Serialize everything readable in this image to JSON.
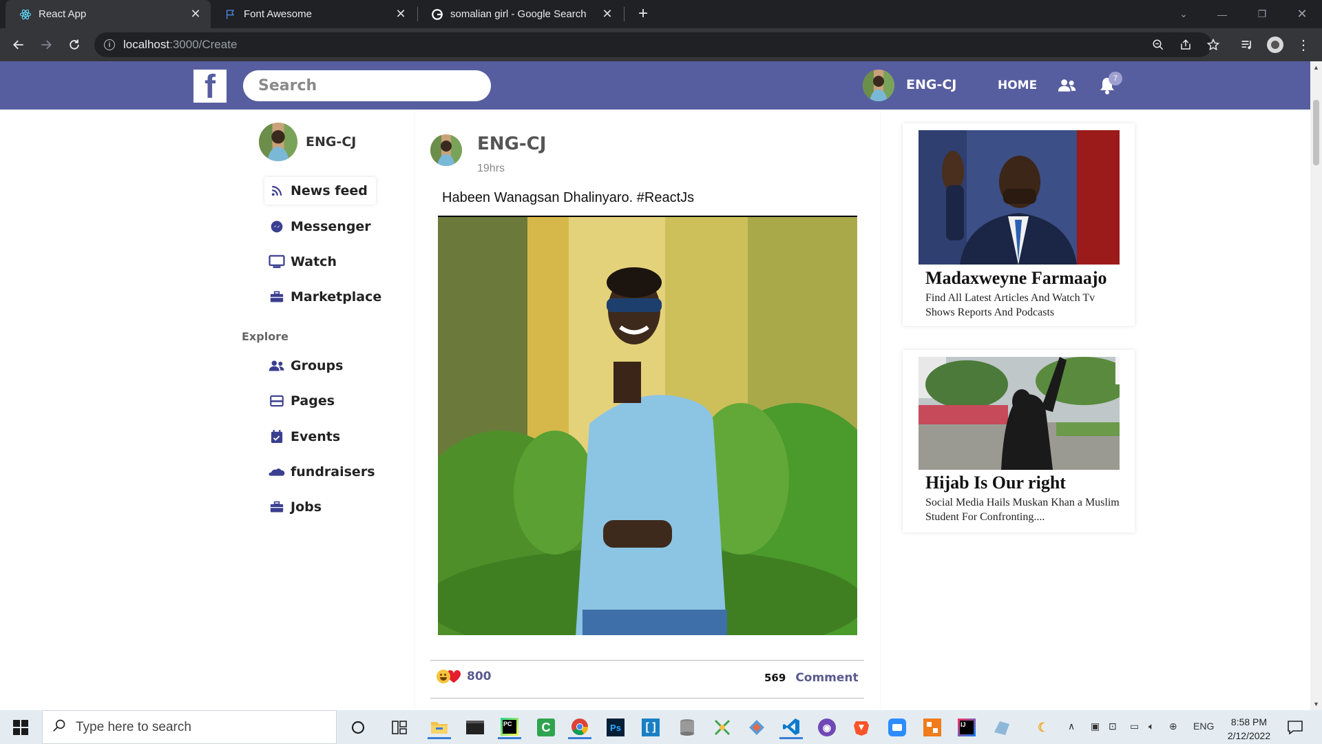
{
  "browser": {
    "tabs": [
      {
        "title": "React App",
        "active": true,
        "icon": "react-icon"
      },
      {
        "title": "Font Awesome",
        "active": false,
        "icon": "flag-icon"
      },
      {
        "title": "somalian girl - Google Search",
        "active": false,
        "icon": "google-icon"
      }
    ],
    "url_host": "localhost",
    "url_path": ":3000/Create"
  },
  "topnav": {
    "search_placeholder": "Search",
    "username": "ENG-CJ",
    "home_label": "HOME",
    "notification_count": "7",
    "brand_color": "#575e9f"
  },
  "sidebar": {
    "username": "ENG-CJ",
    "items": [
      {
        "label": "News feed",
        "icon": "rss-icon"
      },
      {
        "label": "Messenger",
        "icon": "messenger-icon"
      },
      {
        "label": "Watch",
        "icon": "tv-icon"
      },
      {
        "label": "Marketplace",
        "icon": "briefcase-icon"
      }
    ],
    "explore_heading": "Explore",
    "explore_items": [
      {
        "label": "Groups",
        "icon": "users-icon"
      },
      {
        "label": "Pages",
        "icon": "pages-icon"
      },
      {
        "label": "Events",
        "icon": "calendar-icon"
      },
      {
        "label": "fundraisers",
        "icon": "cloud-icon"
      },
      {
        "label": "Jobs",
        "icon": "briefcase-icon"
      }
    ]
  },
  "post": {
    "author": "ENG-CJ",
    "time": "19hrs",
    "text": "Habeen Wanagsan Dhalinyaro. #ReactJs",
    "reactions": "800",
    "comment_count": "569",
    "comment_label": "Comment"
  },
  "ads": [
    {
      "title": "Madaxweyne Farmaajo",
      "description": "Find All Latest Articles And Watch Tv Shows Reports And Podcasts"
    },
    {
      "title": "Hijab Is Our right",
      "description": "Social Media Hails Muskan Khan a Muslim Student For Confronting...."
    }
  ],
  "taskbar": {
    "search_placeholder": "Type here to search",
    "language": "ENG",
    "time": "8:58 PM",
    "date": "2/12/2022"
  }
}
